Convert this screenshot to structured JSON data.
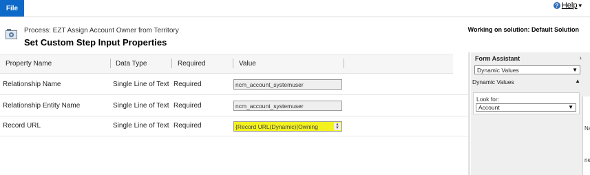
{
  "ribbon": {
    "file_label": "File",
    "help_label": "Help",
    "help_caret": "▾"
  },
  "header": {
    "process_title": "Process: EZT Assign Account Owner from Territory",
    "page_title": "Set Custom Step Input Properties",
    "solution_label": "Working on solution: Default Solution"
  },
  "grid": {
    "columns": [
      "Property Name",
      "Data Type",
      "Required",
      "Value"
    ],
    "rows": [
      {
        "property": "Relationship Name",
        "type": "Single Line of Text",
        "required": "Required",
        "value": "ncm_account_systemuser"
      },
      {
        "property": "Relationship Entity Name",
        "type": "Single Line of Text",
        "required": "Required",
        "value": "ncm_account_systemuser"
      },
      {
        "property": "Record URL",
        "type": "Single Line of Text",
        "required": "Required",
        "value": "{Record URL(Dynamic)(Owning"
      }
    ]
  },
  "form_assistant": {
    "title": "Form Assistant",
    "chevron": "›",
    "dropdown_value": "Dynamic Values",
    "section_label": "Dynamic Values",
    "look_for_label": "Look for:",
    "look_for_value": "Account"
  },
  "edge": {
    "text1": "Na",
    "text2": "ne"
  },
  "colors": {
    "accent": "#0d6ac9",
    "highlight": "#f3f21f"
  }
}
